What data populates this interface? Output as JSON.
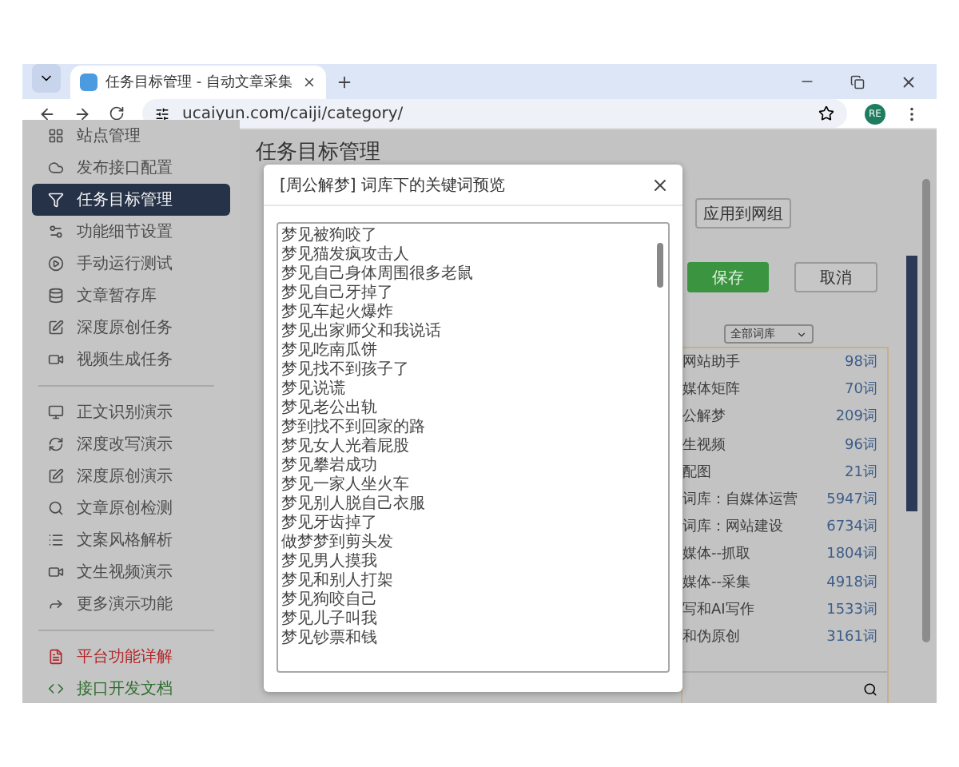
{
  "browser": {
    "tab_title": "任务目标管理 - 自动文章采集",
    "url": "ucaiyun.com/caiji/category/",
    "profile": "RE"
  },
  "sidebar": {
    "items": [
      {
        "label": "站点管理",
        "kind": "nav",
        "selected": false
      },
      {
        "label": "发布接口配置",
        "kind": "nav",
        "selected": false
      },
      {
        "label": "任务目标管理",
        "kind": "nav",
        "selected": true
      },
      {
        "label": "功能细节设置",
        "kind": "nav",
        "selected": false
      },
      {
        "label": "手动运行测试",
        "kind": "nav",
        "selected": false
      },
      {
        "label": "文章暂存库",
        "kind": "nav",
        "selected": false
      },
      {
        "label": "深度原创任务",
        "kind": "nav",
        "selected": false
      },
      {
        "label": "视频生成任务",
        "kind": "nav",
        "selected": false
      },
      {
        "label": "正文识别演示",
        "kind": "nav",
        "selected": false
      },
      {
        "label": "深度改写演示",
        "kind": "nav",
        "selected": false
      },
      {
        "label": "深度原创演示",
        "kind": "nav",
        "selected": false
      },
      {
        "label": "文章原创检测",
        "kind": "nav",
        "selected": false
      },
      {
        "label": "文案风格解析",
        "kind": "nav",
        "selected": false
      },
      {
        "label": "文生视频演示",
        "kind": "nav",
        "selected": false
      },
      {
        "label": "更多演示功能",
        "kind": "nav",
        "selected": false
      },
      {
        "label": "平台功能详解",
        "kind": "help",
        "selected": false
      },
      {
        "label": "接口开发文档",
        "kind": "docs",
        "selected": false
      }
    ]
  },
  "page": {
    "title": "任务目标管理",
    "apply_button": "应用到网组",
    "save_button": "保存",
    "cancel_button": "取消",
    "library_select": "全部词库",
    "libraries": [
      {
        "name": "网站助手",
        "count": "98词"
      },
      {
        "name": "媒体矩阵",
        "count": "70词"
      },
      {
        "name": "公解梦",
        "count": "209词"
      },
      {
        "name": "生视频",
        "count": "96词"
      },
      {
        "name": "配图",
        "count": "21词"
      },
      {
        "name": "词库：自媒体运营",
        "count": "5947词"
      },
      {
        "name": "词库：网站建设",
        "count": "6734词"
      },
      {
        "name": "媒体--抓取",
        "count": "1804词"
      },
      {
        "name": "媒体--采集",
        "count": "4918词"
      },
      {
        "name": "写和AI写作",
        "count": "1533词"
      },
      {
        "name": "和伪原创",
        "count": "3161词"
      }
    ]
  },
  "modal": {
    "title": "[周公解梦] 词库下的关键词预览",
    "keywords": [
      "梦见被狗咬了",
      "梦见猫发疯攻击人",
      "梦见自己身体周围很多老鼠",
      "梦见自己牙掉了",
      "梦见车起火爆炸",
      "梦见出家师父和我说话",
      "梦见吃南瓜饼",
      "梦见找不到孩子了",
      "梦见说谎",
      "梦见老公出轨",
      "梦到找不到回家的路",
      "梦见女人光着屁股",
      "梦见攀岩成功",
      "梦见一家人坐火车",
      "梦见别人脱自己衣服",
      "梦见牙齿掉了",
      "做梦梦到剪头发",
      "梦见男人摸我",
      "梦见和别人打架",
      "梦见狗咬自己",
      "梦见儿子叫我",
      "梦见钞票和钱"
    ]
  }
}
